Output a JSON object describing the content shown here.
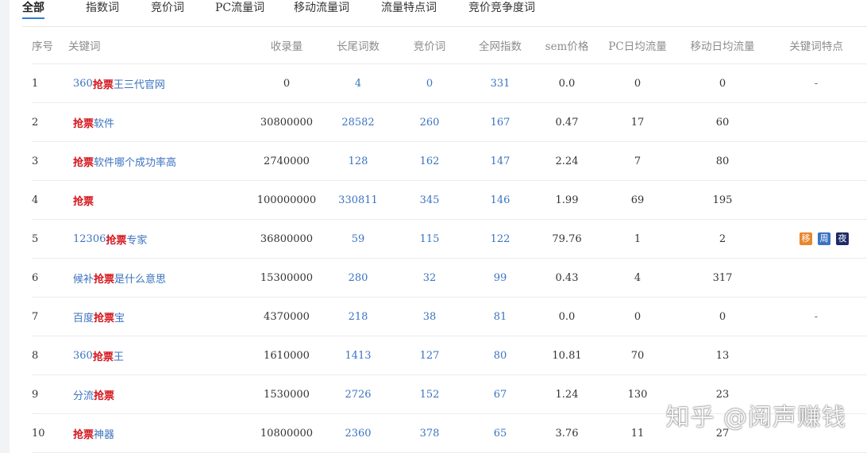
{
  "tabs": [
    {
      "label": "全部",
      "active": true
    },
    {
      "label": "指数词"
    },
    {
      "label": "竞价词"
    },
    {
      "label": "PC流量词"
    },
    {
      "label": "移动流量词"
    },
    {
      "label": "流量特点词"
    },
    {
      "label": "竞价竞争度词"
    }
  ],
  "table": {
    "headers": {
      "idx": "序号",
      "kw": "关键词",
      "shoulu": "收录量",
      "chang": "长尾词数",
      "jing": "竞价词",
      "qw": "全网指数",
      "sem": "sem价格",
      "pc": "PC日均流量",
      "mob": "移动日均流量",
      "feat": "关键词特点"
    },
    "rows": [
      {
        "idx": "1",
        "kw_pre": "360",
        "kw_hl": "抢票",
        "kw_post": "王三代官网",
        "shoulu": "0",
        "chang": "4",
        "jing": "0",
        "qw": "331",
        "sem": "0.0",
        "pc": "0",
        "mob": "0",
        "feat": "-"
      },
      {
        "idx": "2",
        "kw_pre": "",
        "kw_hl": "抢票",
        "kw_post": "软件",
        "shoulu": "30800000",
        "chang": "28582",
        "jing": "260",
        "qw": "167",
        "sem": "0.47",
        "pc": "17",
        "mob": "60",
        "feat": ""
      },
      {
        "idx": "3",
        "kw_pre": "",
        "kw_hl": "抢票",
        "kw_post": "软件哪个成功率高",
        "shoulu": "2740000",
        "chang": "128",
        "jing": "162",
        "qw": "147",
        "sem": "2.24",
        "pc": "7",
        "mob": "80",
        "feat": ""
      },
      {
        "idx": "4",
        "kw_pre": "",
        "kw_hl": "抢票",
        "kw_post": "",
        "shoulu": "100000000",
        "chang": "330811",
        "jing": "345",
        "qw": "146",
        "sem": "1.99",
        "pc": "69",
        "mob": "195",
        "feat": ""
      },
      {
        "idx": "5",
        "kw_pre": "12306",
        "kw_hl": "抢票",
        "kw_post": "专家",
        "shoulu": "36800000",
        "chang": "59",
        "jing": "115",
        "qw": "122",
        "sem": "79.76",
        "pc": "1",
        "mob": "2",
        "feat": "",
        "badges": [
          {
            "label": "移",
            "color": "#e8872c"
          },
          {
            "label": "周",
            "color": "#3a73c1"
          },
          {
            "label": "夜",
            "color": "#1e2a66"
          }
        ]
      },
      {
        "idx": "6",
        "kw_pre": "候补",
        "kw_hl": "抢票",
        "kw_post": "是什么意思",
        "shoulu": "15300000",
        "chang": "280",
        "jing": "32",
        "qw": "99",
        "sem": "0.43",
        "pc": "4",
        "mob": "317",
        "feat": ""
      },
      {
        "idx": "7",
        "kw_pre": "百度",
        "kw_hl": "抢票",
        "kw_post": "宝",
        "shoulu": "4370000",
        "chang": "218",
        "jing": "38",
        "qw": "81",
        "sem": "0.0",
        "pc": "0",
        "mob": "0",
        "feat": "-"
      },
      {
        "idx": "8",
        "kw_pre": "360",
        "kw_hl": "抢票",
        "kw_post": "王",
        "shoulu": "1610000",
        "chang": "1413",
        "jing": "127",
        "qw": "80",
        "sem": "10.81",
        "pc": "70",
        "mob": "13",
        "feat": ""
      },
      {
        "idx": "9",
        "kw_pre": "分流",
        "kw_hl": "抢票",
        "kw_post": "",
        "shoulu": "1530000",
        "chang": "2726",
        "jing": "152",
        "qw": "67",
        "sem": "1.24",
        "pc": "130",
        "mob": "23",
        "feat": ""
      },
      {
        "idx": "10",
        "kw_pre": "",
        "kw_hl": "抢票",
        "kw_post": "神器",
        "shoulu": "10800000",
        "chang": "2360",
        "jing": "378",
        "qw": "65",
        "sem": "3.76",
        "pc": "11",
        "mob": "27",
        "feat": ""
      }
    ]
  },
  "watermark": "知乎 @阅声赚钱"
}
